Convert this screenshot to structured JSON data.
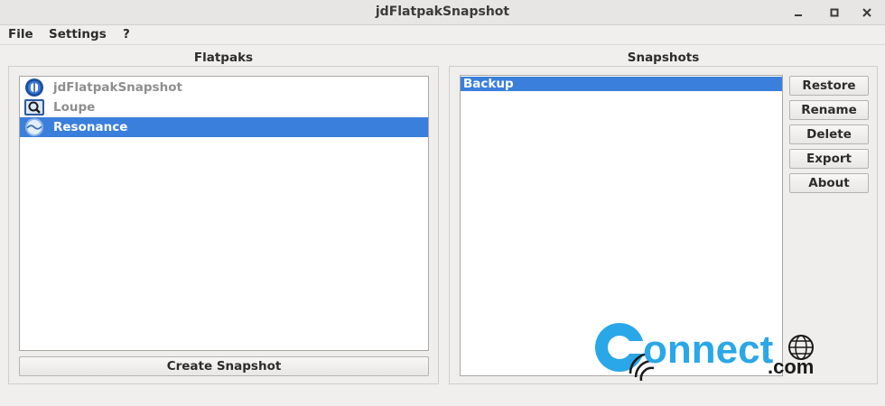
{
  "window": {
    "title": "jdFlatpakSnapshot"
  },
  "menubar": {
    "items": [
      "File",
      "Settings",
      "?"
    ]
  },
  "flatpaks": {
    "title": "Flatpaks",
    "items": [
      {
        "label": "jdFlatpakSnapshot",
        "icon": "jdflatpaksnapshot-app-icon",
        "selected": false
      },
      {
        "label": "Loupe",
        "icon": "loupe-app-icon",
        "selected": false
      },
      {
        "label": "Resonance",
        "icon": "resonance-app-icon",
        "selected": true
      }
    ],
    "create_button": "Create Snapshot"
  },
  "snapshots": {
    "title": "Snapshots",
    "items": [
      {
        "label": "Backup",
        "selected": true
      }
    ],
    "buttons": {
      "restore": "Restore",
      "rename": "Rename",
      "delete": "Delete",
      "export": "Export",
      "about": "About"
    }
  },
  "watermark": {
    "text_main": "onnect",
    "text_com": ".com",
    "colors": {
      "blue": "#2aa7e8",
      "dark": "#1a1a1a"
    }
  },
  "colors": {
    "selection": "#3b7fdc",
    "background": "#f0efee"
  }
}
